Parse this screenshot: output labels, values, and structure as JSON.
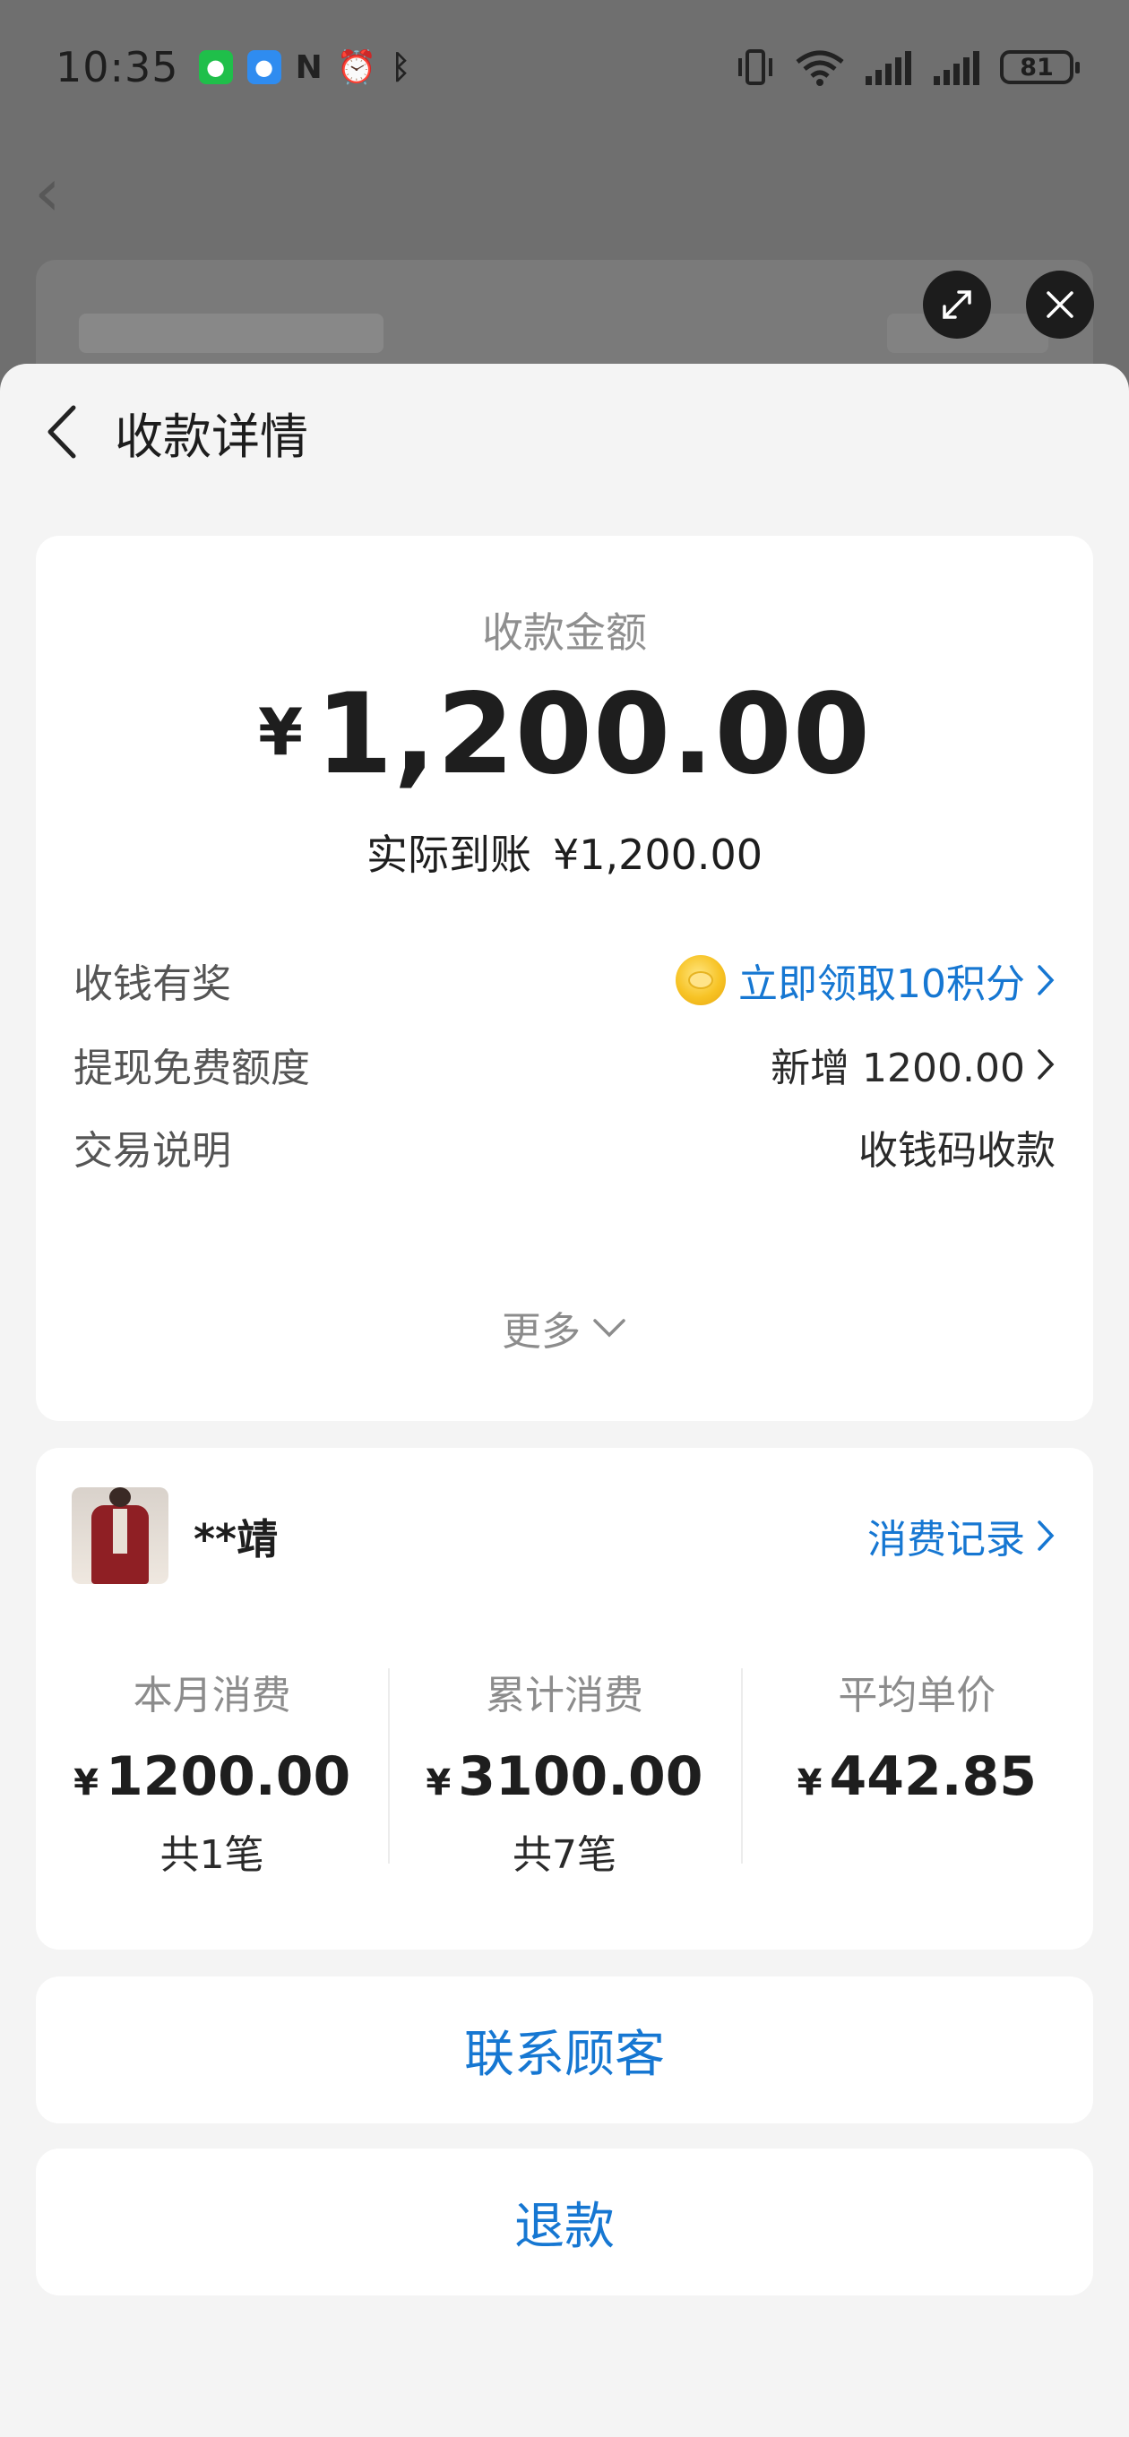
{
  "status_bar": {
    "time": "10:35",
    "left_icons": [
      "wechat-icon",
      "message-icon",
      "nfc-icon",
      "alarm-icon",
      "bluetooth-icon"
    ],
    "right_icons": [
      "vibrate-icon",
      "wifi-icon",
      "signal-icon",
      "signal-icon"
    ],
    "battery": "81"
  },
  "sheet": {
    "title": "收款详情"
  },
  "amount": {
    "label": "收款金额",
    "currency": "¥",
    "value": "1,200.00",
    "actual_label": "实际到账",
    "actual_value": "¥1,200.00"
  },
  "details": [
    {
      "key": "收钱有奖",
      "value": "立即领取10积分"
    },
    {
      "key": "提现免费额度",
      "value": "新增 1200.00"
    },
    {
      "key": "交易说明",
      "value": "收钱码收款"
    }
  ],
  "more_label": "更多",
  "customer": {
    "name": "**靖",
    "records_link": "消费记录",
    "stats": [
      {
        "label": "本月消费",
        "currency": "¥",
        "value": "1200.00",
        "count": "共1笔"
      },
      {
        "label": "累计消费",
        "currency": "¥",
        "value": "3100.00",
        "count": "共7笔"
      },
      {
        "label": "平均单价",
        "currency": "¥",
        "value": "442.85",
        "count": ""
      }
    ]
  },
  "actions": {
    "contact": "联系顾客",
    "refund": "退款"
  },
  "colors": {
    "accent": "#1677d2",
    "sheet_background": "#f4f4f4",
    "card_background": "#ffffff",
    "overlay": "#6f6f6f"
  }
}
